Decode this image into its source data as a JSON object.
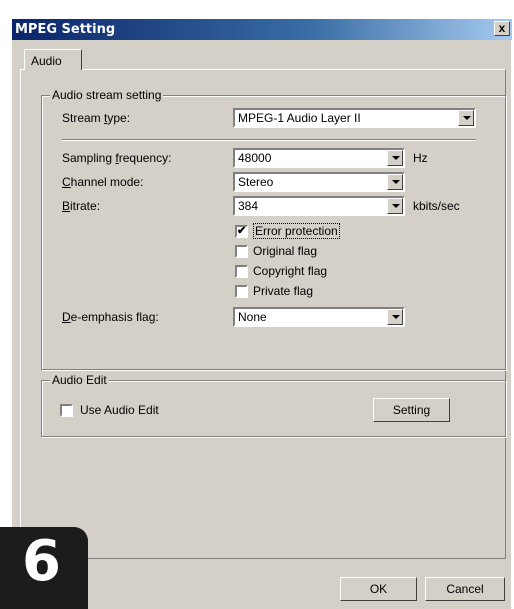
{
  "window": {
    "title": "MPEG Setting",
    "close_label": "x"
  },
  "tabs": [
    {
      "label": "Audio"
    }
  ],
  "stream_group": {
    "title": "Audio stream setting",
    "stream_type": {
      "label_pre": "Stream ",
      "label_u": "t",
      "label_post": "ype:",
      "value": "MPEG-1 Audio Layer II"
    },
    "sampling": {
      "label_pre": "Sampling ",
      "label_u": "f",
      "label_post": "requency:",
      "value": "48000",
      "unit": "Hz"
    },
    "channel": {
      "label_pre": "",
      "label_u": "C",
      "label_post": "hannel mode:",
      "value": "Stereo"
    },
    "bitrate": {
      "label_pre": "",
      "label_u": "B",
      "label_post": "itrate:",
      "value": "384",
      "unit": "kbits/sec"
    },
    "checkboxes": [
      {
        "label": "Error protection",
        "checked": true
      },
      {
        "label": "Original flag",
        "checked": false
      },
      {
        "label": "Copyright flag",
        "checked": false
      },
      {
        "label": "Private flag",
        "checked": false
      }
    ],
    "deemphasis": {
      "label_pre": "",
      "label_u": "D",
      "label_post": "e-emphasis flag:",
      "value": "None"
    }
  },
  "edit_group": {
    "title": "Audio Edit",
    "use_audio_edit": {
      "label": "Use Audio Edit",
      "checked": false
    },
    "setting_label": "Setting"
  },
  "footer": {
    "ok_label": "OK",
    "cancel_label": "Cancel"
  },
  "badge": {
    "number": "6"
  },
  "checkmark": "✔"
}
